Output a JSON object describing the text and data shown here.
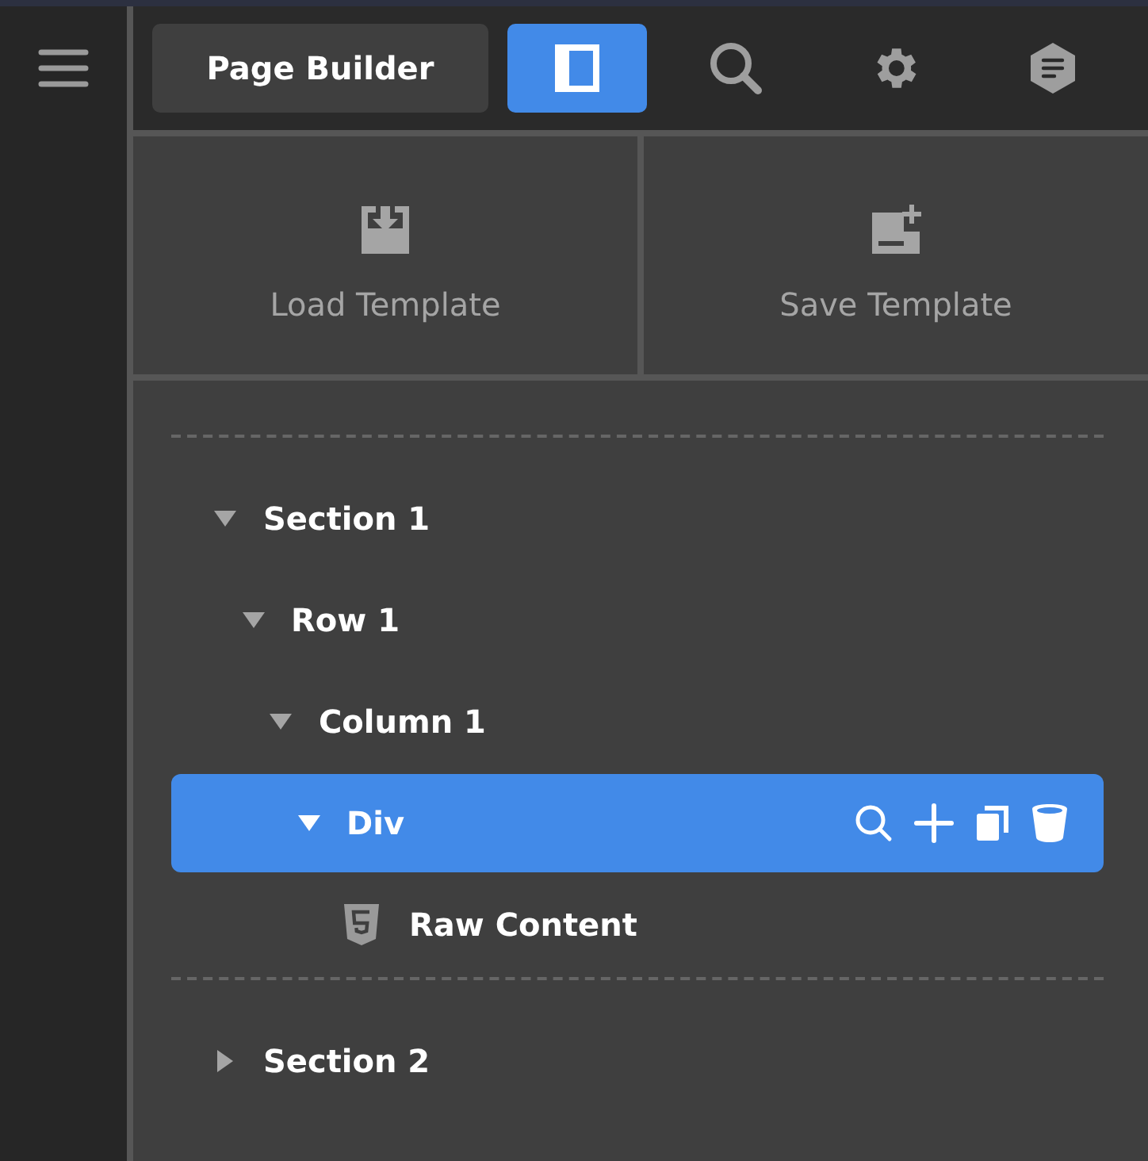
{
  "header": {
    "title": "Page Builder",
    "tools": [
      {
        "kind": "layout",
        "selected": true
      },
      {
        "kind": "search",
        "selected": false
      },
      {
        "kind": "settings",
        "selected": false
      },
      {
        "kind": "notes",
        "selected": false
      }
    ]
  },
  "templates": [
    {
      "kind": "load",
      "label": "Load Template"
    },
    {
      "kind": "save",
      "label": "Save Template"
    }
  ],
  "tree": [
    {
      "kind": "group",
      "label": "Section 1",
      "expanded": true,
      "selected": false,
      "children": [
        {
          "kind": "group",
          "label": "Row 1",
          "expanded": true,
          "selected": false,
          "children": [
            {
              "kind": "group",
              "label": "Column 1",
              "expanded": true,
              "selected": false,
              "children": [
                {
                  "kind": "group",
                  "label": "Div",
                  "expanded": true,
                  "selected": true,
                  "children": [
                    {
                      "kind": "html",
                      "label": "Raw Content",
                      "selected": false
                    }
                  ]
                }
              ]
            }
          ]
        }
      ]
    },
    {
      "kind": "group",
      "label": "Section 2",
      "expanded": false,
      "selected": false
    }
  ]
}
